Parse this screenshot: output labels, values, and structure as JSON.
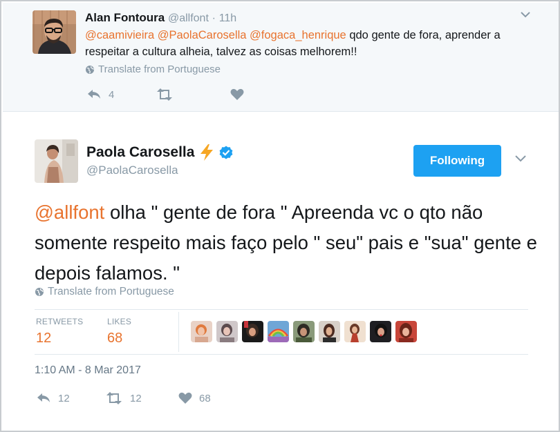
{
  "reply_tweet": {
    "name": "Alan Fontoura",
    "handle": "@allfont",
    "separator": "·",
    "time": "11h",
    "mentions": [
      "@caamivieira",
      "@PaolaCarosella",
      "@fogaca_henrique"
    ],
    "body": "qdo gente de fora, aprender a respeitar a cultura alheia, talvez as coisas melhorem!!",
    "translate_label": "Translate from Portuguese",
    "reply_count": "4",
    "retweet_count": "",
    "like_count": ""
  },
  "main_tweet": {
    "name": "Paola Carosella",
    "name_emoji": "⚡",
    "handle": "@PaolaCarosella",
    "follow_label": "Following",
    "mention": "@allfont",
    "body": " olha \" gente de fora \" Apreenda vc o qto não somente respeito mais faço pelo \" seu\" pais e \"sua\" gente e depois falamos. \"",
    "translate_label": "Translate from Portuguese",
    "retweets_label": "RETWEETS",
    "retweets_count": "12",
    "likes_label": "LIKES",
    "likes_count": "68",
    "timestamp": "1:10 AM - 8 Mar 2017",
    "reply_count": "12",
    "retweet_count": "12",
    "like_count": "68"
  },
  "colors": {
    "accent": "#e8732e",
    "follow_button": "#1da1f2",
    "verified": "#1da1f2",
    "muted": "#8899a6"
  },
  "icons": [
    "avatar-photo",
    "verified-badge-icon",
    "lightning-emoji",
    "globe-icon",
    "reply-icon",
    "retweet-icon",
    "heart-icon",
    "chevron-down-icon"
  ]
}
